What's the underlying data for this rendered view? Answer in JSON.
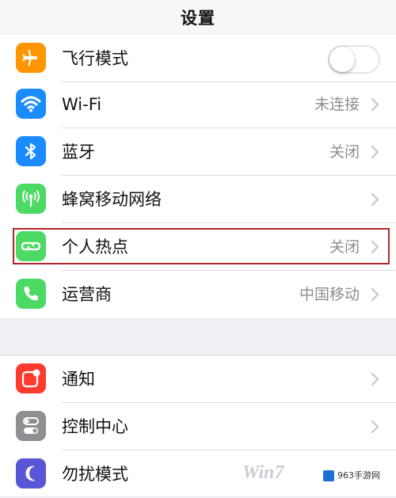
{
  "nav": {
    "title": "设置"
  },
  "group1": [
    {
      "id": "airplane",
      "label": "飞行模式",
      "value": "",
      "icon": "airplane-icon",
      "color": "#ff9500",
      "accessory": "toggle",
      "toggle_on": false
    },
    {
      "id": "wifi",
      "label": "Wi-Fi",
      "value": "未连接",
      "icon": "wifi-icon",
      "color": "#1a8cff",
      "accessory": "chevron"
    },
    {
      "id": "bluetooth",
      "label": "蓝牙",
      "value": "关闭",
      "icon": "bluetooth-icon",
      "color": "#1a8cff",
      "accessory": "chevron"
    },
    {
      "id": "cellular",
      "label": "蜂窝移动网络",
      "value": "",
      "icon": "cellular-icon",
      "color": "#4cd964",
      "accessory": "chevron"
    },
    {
      "id": "hotspot",
      "label": "个人热点",
      "value": "关闭",
      "icon": "hotspot-icon",
      "color": "#4cd964",
      "accessory": "chevron",
      "highlighted": true
    },
    {
      "id": "carrier",
      "label": "运营商",
      "value": "中国移动",
      "icon": "phone-icon",
      "color": "#4cd964",
      "accessory": "chevron"
    }
  ],
  "group2": [
    {
      "id": "notifications",
      "label": "通知",
      "value": "",
      "icon": "notifications-icon",
      "color": "#ff3b30",
      "accessory": "chevron"
    },
    {
      "id": "control-center",
      "label": "控制中心",
      "value": "",
      "icon": "control-center-icon",
      "color": "#8e8e93",
      "accessory": "chevron"
    },
    {
      "id": "do-not-disturb",
      "label": "勿扰模式",
      "value": "",
      "icon": "moon-icon",
      "color": "#5856d6",
      "accessory": "chevron"
    }
  ],
  "highlight_color": "#b3262b",
  "watermark": {
    "brand": "Win7",
    "site": "963手游网"
  }
}
